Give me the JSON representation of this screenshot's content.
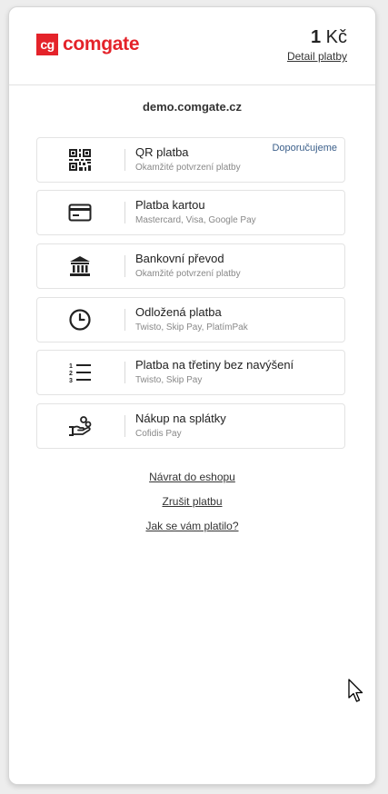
{
  "brand": {
    "logo_mark": "cg",
    "logo_text": "comgate",
    "color": "#e4232a"
  },
  "header": {
    "amount_value": "1",
    "amount_currency": "Kč",
    "detail_link": "Detail platby"
  },
  "merchant": "demo.comgate.cz",
  "methods": [
    {
      "title": "QR platba",
      "subtitle": "Okamžité potvrzení platby",
      "icon": "qr-code-icon",
      "badge": "Doporučujeme"
    },
    {
      "title": "Platba kartou",
      "subtitle": "Mastercard, Visa, Google Pay",
      "icon": "credit-card-icon"
    },
    {
      "title": "Bankovní převod",
      "subtitle": "Okamžité potvrzení platby",
      "icon": "bank-icon"
    },
    {
      "title": "Odložená platba",
      "subtitle": "Twisto, Skip Pay, PlatímPak",
      "icon": "clock-icon"
    },
    {
      "title": "Platba na třetiny bez navýšení",
      "subtitle": "Twisto, Skip Pay",
      "icon": "numbered-list-icon"
    },
    {
      "title": "Nákup na splátky",
      "subtitle": "Cofidis Pay",
      "icon": "hand-coins-icon"
    }
  ],
  "links": {
    "back": "Návrat do eshopu",
    "cancel": "Zrušit platbu",
    "feedback": "Jak se vám platilo?"
  }
}
